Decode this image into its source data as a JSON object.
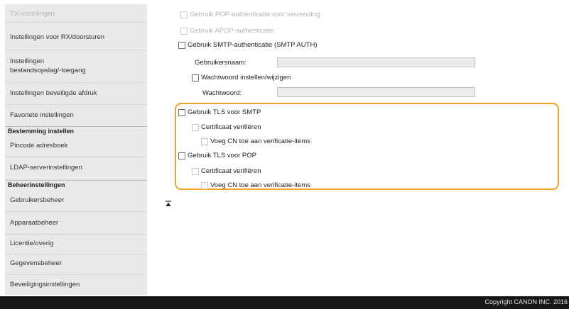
{
  "sidebar": {
    "items": [
      {
        "label": "TX-instellingen"
      },
      {
        "label": "Instellingen voor RX/doorsturen"
      },
      {
        "label": "Instellingen bestandsopslag/-toegang"
      },
      {
        "label": "Instellingen beveiligde afdruk"
      },
      {
        "label": "Favoriete instellingen"
      },
      {
        "label": "Pincode adresboek"
      },
      {
        "label": "LDAP-serverinstellingen"
      },
      {
        "label": "Gebruikersbeheer"
      },
      {
        "label": "Apparaatbeheer"
      },
      {
        "label": "Licentie/overig"
      },
      {
        "label": "Gegevensbeheer"
      },
      {
        "label": "Beveiligingsinstellingen"
      }
    ],
    "headers": {
      "bestemming": "Bestemming instellen",
      "beheer": "Beheerinstellingen"
    }
  },
  "settings": {
    "pop_auth_before_send": "Gebruik POP-authenticatie voor verzending",
    "apop_auth": "Gebruik APOP-authenticatie",
    "smtp_auth": "Gebruik SMTP-authenticatie (SMTP AUTH)",
    "username_label": "Gebruikersnaam:",
    "set_change_password": "Wachtwoord instellen/wijzigen",
    "password_label": "Wachtwoord:",
    "tls_smtp": "Gebruik TLS voor SMTP",
    "verify_cert_smtp": "Certificaat verifiëren",
    "add_cn_smtp": "Voeg CN toe aan verificatie-items",
    "tls_pop": "Gebruik TLS voor POP",
    "verify_cert_pop": "Certificaat verifiëren",
    "add_cn_pop": "Voeg CN toe aan verificatie-items"
  },
  "footer": {
    "copyright": "Copyright CANON INC. 2016"
  },
  "colors": {
    "highlight": "#f0a322",
    "sidebar_bg": "#e9e9e9",
    "footer_bg": "#171717"
  },
  "icons": {
    "back_to_top": "back-to-top-icon"
  }
}
